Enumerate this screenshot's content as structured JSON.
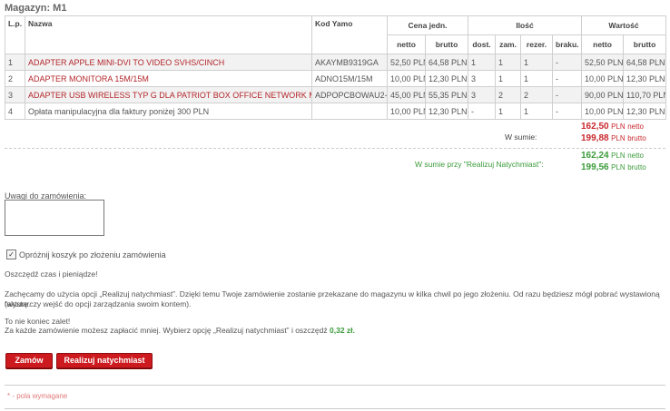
{
  "page": {
    "title": "Magazyn: M1"
  },
  "table": {
    "headers": {
      "lp": "L.p.",
      "name": "Nazwa",
      "code": "Kod Yamo",
      "price_group": "Cena jedn.",
      "qty_group": "Ilość",
      "value_group": "Wartość",
      "netto": "netto",
      "brutto": "brutto",
      "dost": "dost.",
      "zam": "zam.",
      "rezer": "rezer.",
      "braku": "braku.",
      "v_netto": "netto",
      "v_brutto": "brutto"
    },
    "rows": [
      {
        "lp": "1",
        "name": "ADAPTER APPLE MINI-DVI TO VIDEO SVHS/CINCH",
        "code": "AKAYMB9319GA",
        "netto": "52,50 PLN",
        "brutto": "64,58 PLN",
        "dost": "1",
        "zam": "1",
        "rezer": "1",
        "braku": "-",
        "v_netto": "52,50 PLN",
        "v_brutto": "64,58 PLN"
      },
      {
        "lp": "2",
        "name": "ADAPTER MONITORA 15M/15M",
        "code": "ADNO15M/15M",
        "netto": "10,00 PLN",
        "brutto": "12,30 PLN",
        "dost": "3",
        "zam": "1",
        "rezer": "1",
        "braku": "-",
        "v_netto": "10,00 PLN",
        "v_brutto": "12,30 PLN"
      },
      {
        "lp": "3",
        "name": "ADAPTER USB WIRELESS TYP G DLA PATRIOT BOX OFFICE NETWORK MEDIA TANK",
        "code": "ADPOPCBOWAU2-G",
        "netto": "45,00 PLN",
        "brutto": "55,35 PLN",
        "dost": "3",
        "zam": "2",
        "rezer": "2",
        "braku": "-",
        "v_netto": "90,00 PLN",
        "v_brutto": "110,70 PLN"
      },
      {
        "lp": "4",
        "name": "Opłata manipulacyjna dla faktury poniżej 300 PLN",
        "code": "",
        "netto": "10,00 PLN",
        "brutto": "12,30 PLN",
        "dost": "-",
        "zam": "1",
        "rezer": "1",
        "braku": "-",
        "v_netto": "10,00 PLN",
        "v_brutto": "12,30 PLN"
      }
    ]
  },
  "summary": {
    "label": "W sumie:",
    "netto_value": "162,50",
    "brutto_value": "199,88",
    "currency": "PLN",
    "netto_word": "netto",
    "brutto_word": "brutto",
    "instant_label": "W sumie przy \"Realizuj Natychmiast\":",
    "instant_netto_value": "162,24",
    "instant_brutto_value": "199,56"
  },
  "form": {
    "notes_label": "Uwagi do zamówienia:",
    "notes_value": "",
    "empty_cart_label": "Opróżnij koszyk po złożeniu zamówienia",
    "empty_cart_checked": "✓"
  },
  "info": {
    "line1": "Oszczędź czas i pieniądze!",
    "line2": "Zachęcamy do użycia opcji „Realizuj natychmiast”. Dzięki temu Twoje zamówienie zostanie przekazane do magazynu w kilka chwil po jego złożeniu. Od razu będziesz mógł pobrać wystawioną fakturę.",
    "line3": "(wystarczy wejść do opcji zarządzania swoim kontem).",
    "line4": "To nie koniec zalet!",
    "line5_prefix": "Za każde zamówienie możesz zapłacić mniej. Wybierz opcję „Realizuj natychmiast” i oszczędź",
    "line5_saving": "0,32 zł."
  },
  "buttons": {
    "order": "Zamów",
    "instant": "Realizuj natychmiast"
  },
  "footer": {
    "required": "* - pola wymagane"
  },
  "colors": {
    "accent_red": "#cc1a1f",
    "link_red": "#b3262b",
    "green": "#3a9b3a"
  }
}
